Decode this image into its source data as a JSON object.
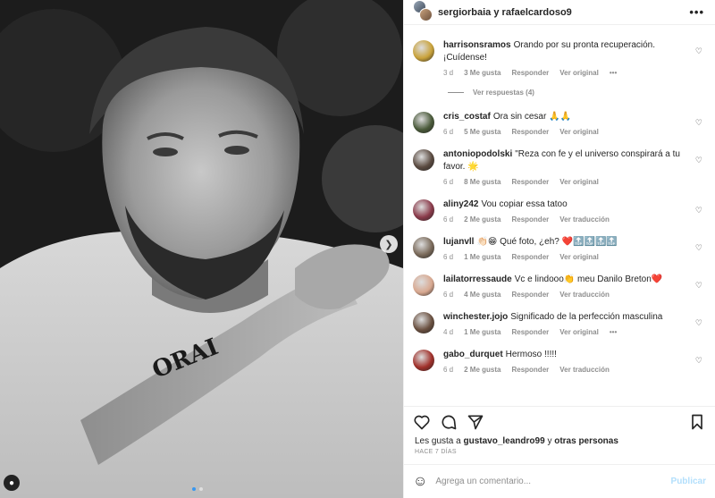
{
  "header": {
    "owners": "sergiorbaia y rafaelcardoso9",
    "more_icon": "more-horizontal-icon"
  },
  "photo": {
    "tattoo_text": "ORAI",
    "carousel": {
      "count": 2,
      "active": 1
    }
  },
  "comments": [
    {
      "user": "harrisonsramos",
      "text": "Orando por su pronta recuperación. ¡Cuídense!",
      "ago": "3 d",
      "likes": "3 Me gusta",
      "reply": "Responder",
      "action": "Ver original",
      "has_more": true,
      "replies": "Ver respuestas (4)",
      "avatar_color": "#c9a23a"
    },
    {
      "user": "cris_costaf",
      "text": "Ora sin cesar 🙏🙏",
      "ago": "6 d",
      "likes": "5 Me gusta",
      "reply": "Responder",
      "action": "Ver original",
      "avatar_color": "#4a5a3a"
    },
    {
      "user": "antoniopodolski",
      "text": "\"Reza con fe y el universo conspirará a tu favor. 🌟",
      "ago": "6 d",
      "likes": "8 Me gusta",
      "reply": "Responder",
      "action": "Ver original",
      "avatar_color": "#5a4a40"
    },
    {
      "user": "aliny242",
      "text": "Vou copiar essa tatoo",
      "ago": "6 d",
      "likes": "2 Me gusta",
      "reply": "Responder",
      "action": "Ver traducción",
      "avatar_color": "#8a3a4a"
    },
    {
      "user": "lujanvll",
      "text": "👏🏻😁 Qué foto, ¿eh? ❤️🔝🔝🔝🔝",
      "ago": "6 d",
      "likes": "1 Me gusta",
      "reply": "Responder",
      "action": "Ver original",
      "avatar_color": "#7a6a5a"
    },
    {
      "user": "lailatorressaude",
      "text": "Vc e lindooo👏 meu Danilo Breton❤️",
      "ago": "6 d",
      "likes": "4 Me gusta",
      "reply": "Responder",
      "action": "Ver traducción",
      "avatar_color": "#d8a890"
    },
    {
      "user": "winchester.jojo",
      "text": "Significado de la perfección masculina",
      "ago": "4 d",
      "likes": "1 Me gusta",
      "reply": "Responder",
      "action": "Ver original",
      "has_more": true,
      "avatar_color": "#6a5040"
    },
    {
      "user": "gabo_durquet",
      "text": "Hermoso !!!!!",
      "ago": "6 d",
      "likes": "2 Me gusta",
      "reply": "Responder",
      "action": "Ver traducción",
      "avatar_color": "#a0302a"
    }
  ],
  "actions": {
    "like_icon": "heart-icon",
    "comment_icon": "comment-icon",
    "share_icon": "send-icon",
    "save_icon": "bookmark-icon"
  },
  "likes": {
    "prefix": "Les gusta a",
    "user": "gustavo_leandro99",
    "conj": "y",
    "others": "otras personas"
  },
  "when": "HACE 7 DÍAS",
  "add_comment": {
    "placeholder": "Agrega un comentario...",
    "publish": "Publicar",
    "emoji_icon": "smiley-icon"
  },
  "colors": {
    "link_disabled": "#b2dffc",
    "muted": "#8e8e8e",
    "carousel_active": "#3897f0"
  }
}
